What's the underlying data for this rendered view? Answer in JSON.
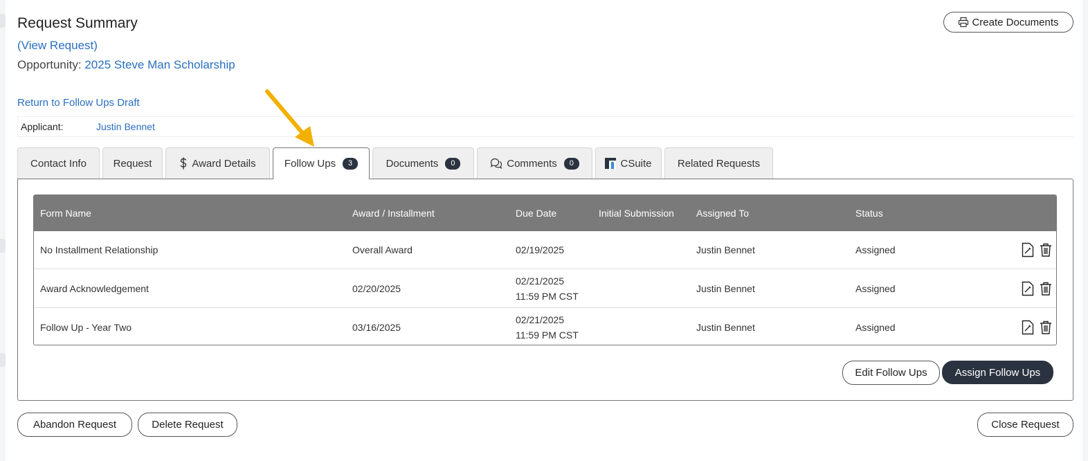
{
  "header": {
    "title": "Request Summary",
    "view_request": "(View Request)",
    "opportunity_label": "Opportunity:",
    "opportunity_value": "2025 Steve Man Scholarship",
    "create_documents": "Create Documents",
    "return_link": "Return to Follow Ups Draft"
  },
  "applicant": {
    "label": "Applicant:",
    "name": "Justin Bennet"
  },
  "tabs": [
    {
      "label": "Contact Info"
    },
    {
      "label": "Request"
    },
    {
      "label": "Award Details",
      "icon": "dollar-icon"
    },
    {
      "label": "Follow Ups",
      "badge": "3",
      "active": true
    },
    {
      "label": "Documents",
      "badge": "0"
    },
    {
      "label": "Comments",
      "badge": "0",
      "icon": "comments-icon"
    },
    {
      "label": "CSuite",
      "icon": "csuite-logo-icon"
    },
    {
      "label": "Related Requests"
    }
  ],
  "table": {
    "columns": [
      "Form Name",
      "Award / Installment",
      "Due Date",
      "Initial Submission",
      "Assigned To",
      "Status"
    ],
    "rows": [
      {
        "form_name": "No Installment Relationship",
        "award": "Overall Award",
        "due_line1": "02/19/2025",
        "due_line2": "",
        "initial": "",
        "assigned": "Justin Bennet",
        "status": "Assigned"
      },
      {
        "form_name": "Award Acknowledgement",
        "award": "02/20/2025",
        "due_line1": "02/21/2025",
        "due_line2": "11:59 PM CST",
        "initial": "",
        "assigned": "Justin Bennet",
        "status": "Assigned"
      },
      {
        "form_name": "Follow Up - Year Two",
        "award": "03/16/2025",
        "due_line1": "02/21/2025",
        "due_line2": "11:59 PM CST",
        "initial": "",
        "assigned": "Justin Bennet",
        "status": "Assigned"
      }
    ]
  },
  "actions": {
    "edit_follow_ups": "Edit Follow Ups",
    "assign_follow_ups": "Assign Follow Ups",
    "abandon_request": "Abandon Request",
    "delete_request": "Delete Request",
    "close_request": "Close Request"
  },
  "colors": {
    "link": "#2a6fc0",
    "dark_button": "#2b3340",
    "table_header": "#7a7a7a",
    "annotation_arrow": "#f2b100"
  }
}
